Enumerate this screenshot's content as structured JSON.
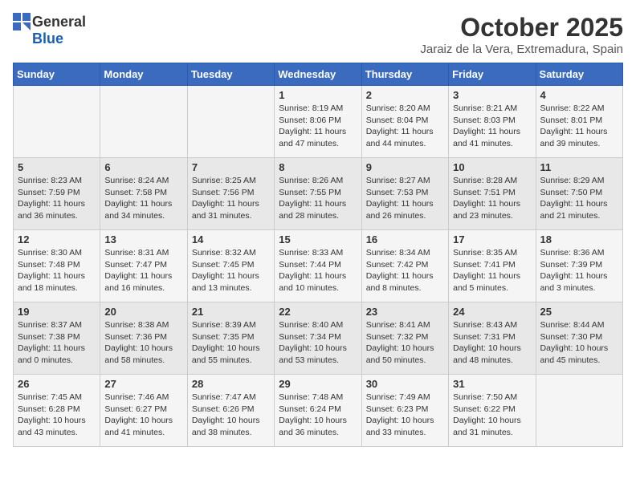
{
  "logo": {
    "general": "General",
    "blue": "Blue"
  },
  "title": "October 2025",
  "location": "Jaraiz de la Vera, Extremadura, Spain",
  "days_of_week": [
    "Sunday",
    "Monday",
    "Tuesday",
    "Wednesday",
    "Thursday",
    "Friday",
    "Saturday"
  ],
  "weeks": [
    [
      {
        "day": "",
        "info": ""
      },
      {
        "day": "",
        "info": ""
      },
      {
        "day": "",
        "info": ""
      },
      {
        "day": "1",
        "info": "Sunrise: 8:19 AM\nSunset: 8:06 PM\nDaylight: 11 hours and 47 minutes."
      },
      {
        "day": "2",
        "info": "Sunrise: 8:20 AM\nSunset: 8:04 PM\nDaylight: 11 hours and 44 minutes."
      },
      {
        "day": "3",
        "info": "Sunrise: 8:21 AM\nSunset: 8:03 PM\nDaylight: 11 hours and 41 minutes."
      },
      {
        "day": "4",
        "info": "Sunrise: 8:22 AM\nSunset: 8:01 PM\nDaylight: 11 hours and 39 minutes."
      }
    ],
    [
      {
        "day": "5",
        "info": "Sunrise: 8:23 AM\nSunset: 7:59 PM\nDaylight: 11 hours and 36 minutes."
      },
      {
        "day": "6",
        "info": "Sunrise: 8:24 AM\nSunset: 7:58 PM\nDaylight: 11 hours and 34 minutes."
      },
      {
        "day": "7",
        "info": "Sunrise: 8:25 AM\nSunset: 7:56 PM\nDaylight: 11 hours and 31 minutes."
      },
      {
        "day": "8",
        "info": "Sunrise: 8:26 AM\nSunset: 7:55 PM\nDaylight: 11 hours and 28 minutes."
      },
      {
        "day": "9",
        "info": "Sunrise: 8:27 AM\nSunset: 7:53 PM\nDaylight: 11 hours and 26 minutes."
      },
      {
        "day": "10",
        "info": "Sunrise: 8:28 AM\nSunset: 7:51 PM\nDaylight: 11 hours and 23 minutes."
      },
      {
        "day": "11",
        "info": "Sunrise: 8:29 AM\nSunset: 7:50 PM\nDaylight: 11 hours and 21 minutes."
      }
    ],
    [
      {
        "day": "12",
        "info": "Sunrise: 8:30 AM\nSunset: 7:48 PM\nDaylight: 11 hours and 18 minutes."
      },
      {
        "day": "13",
        "info": "Sunrise: 8:31 AM\nSunset: 7:47 PM\nDaylight: 11 hours and 16 minutes."
      },
      {
        "day": "14",
        "info": "Sunrise: 8:32 AM\nSunset: 7:45 PM\nDaylight: 11 hours and 13 minutes."
      },
      {
        "day": "15",
        "info": "Sunrise: 8:33 AM\nSunset: 7:44 PM\nDaylight: 11 hours and 10 minutes."
      },
      {
        "day": "16",
        "info": "Sunrise: 8:34 AM\nSunset: 7:42 PM\nDaylight: 11 hours and 8 minutes."
      },
      {
        "day": "17",
        "info": "Sunrise: 8:35 AM\nSunset: 7:41 PM\nDaylight: 11 hours and 5 minutes."
      },
      {
        "day": "18",
        "info": "Sunrise: 8:36 AM\nSunset: 7:39 PM\nDaylight: 11 hours and 3 minutes."
      }
    ],
    [
      {
        "day": "19",
        "info": "Sunrise: 8:37 AM\nSunset: 7:38 PM\nDaylight: 11 hours and 0 minutes."
      },
      {
        "day": "20",
        "info": "Sunrise: 8:38 AM\nSunset: 7:36 PM\nDaylight: 10 hours and 58 minutes."
      },
      {
        "day": "21",
        "info": "Sunrise: 8:39 AM\nSunset: 7:35 PM\nDaylight: 10 hours and 55 minutes."
      },
      {
        "day": "22",
        "info": "Sunrise: 8:40 AM\nSunset: 7:34 PM\nDaylight: 10 hours and 53 minutes."
      },
      {
        "day": "23",
        "info": "Sunrise: 8:41 AM\nSunset: 7:32 PM\nDaylight: 10 hours and 50 minutes."
      },
      {
        "day": "24",
        "info": "Sunrise: 8:43 AM\nSunset: 7:31 PM\nDaylight: 10 hours and 48 minutes."
      },
      {
        "day": "25",
        "info": "Sunrise: 8:44 AM\nSunset: 7:30 PM\nDaylight: 10 hours and 45 minutes."
      }
    ],
    [
      {
        "day": "26",
        "info": "Sunrise: 7:45 AM\nSunset: 6:28 PM\nDaylight: 10 hours and 43 minutes."
      },
      {
        "day": "27",
        "info": "Sunrise: 7:46 AM\nSunset: 6:27 PM\nDaylight: 10 hours and 41 minutes."
      },
      {
        "day": "28",
        "info": "Sunrise: 7:47 AM\nSunset: 6:26 PM\nDaylight: 10 hours and 38 minutes."
      },
      {
        "day": "29",
        "info": "Sunrise: 7:48 AM\nSunset: 6:24 PM\nDaylight: 10 hours and 36 minutes."
      },
      {
        "day": "30",
        "info": "Sunrise: 7:49 AM\nSunset: 6:23 PM\nDaylight: 10 hours and 33 minutes."
      },
      {
        "day": "31",
        "info": "Sunrise: 7:50 AM\nSunset: 6:22 PM\nDaylight: 10 hours and 31 minutes."
      },
      {
        "day": "",
        "info": ""
      }
    ]
  ]
}
